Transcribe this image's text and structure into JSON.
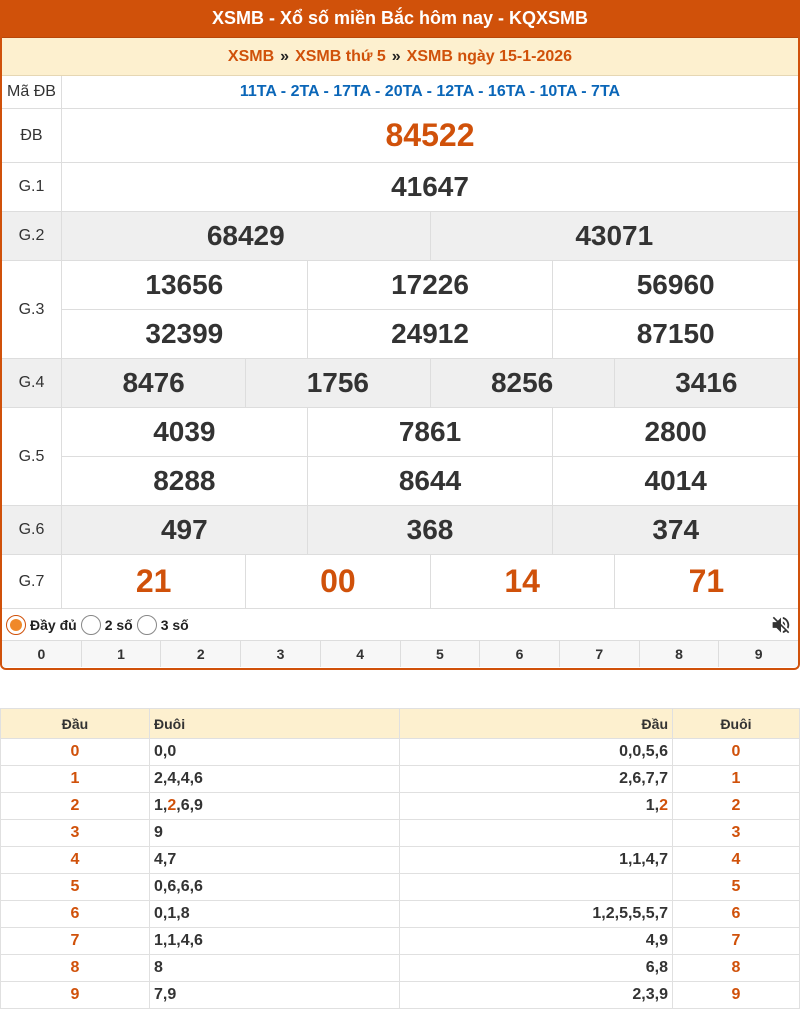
{
  "header": {
    "title": "XSMB - Xổ số miền Bắc hôm nay - KQXSMB"
  },
  "breadcrumb": {
    "item1": "XSMB",
    "item2": "XSMB thứ 5",
    "item3": "XSMB ngày 15-1-2026",
    "separator": "»"
  },
  "results": {
    "ma_db": {
      "label": "Mã ĐB",
      "codes": "11TA - 2TA - 17TA - 20TA - 12TA - 16TA - 10TA - 7TA"
    },
    "db": {
      "label": "ĐB",
      "numbers": [
        "84522"
      ]
    },
    "g1": {
      "label": "G.1",
      "numbers": [
        "41647"
      ]
    },
    "g2": {
      "label": "G.2",
      "numbers": [
        "68429",
        "43071"
      ]
    },
    "g3": {
      "label": "G.3",
      "numbers": [
        "13656",
        "17226",
        "56960",
        "32399",
        "24912",
        "87150"
      ]
    },
    "g4": {
      "label": "G.4",
      "numbers": [
        "8476",
        "1756",
        "8256",
        "3416"
      ]
    },
    "g5": {
      "label": "G.5",
      "numbers": [
        "4039",
        "7861",
        "2800",
        "8288",
        "8644",
        "4014"
      ]
    },
    "g6": {
      "label": "G.6",
      "numbers": [
        "497",
        "368",
        "374"
      ]
    },
    "g7": {
      "label": "G.7",
      "numbers": [
        "21",
        "00",
        "14",
        "71"
      ]
    }
  },
  "options": {
    "full": "Đầy đủ",
    "two": "2 số",
    "three": "3 số",
    "selected": "full"
  },
  "mute_icon": "volume-off-icon",
  "digits": [
    "0",
    "1",
    "2",
    "3",
    "4",
    "5",
    "6",
    "7",
    "8",
    "9"
  ],
  "loto_table": {
    "headers": {
      "dau": "Đầu",
      "duoi": "Đuôi",
      "dau2": "Đầu",
      "duoi2": "Đuôi"
    },
    "rows": [
      {
        "dau": "0",
        "duoi": "0,0",
        "dau2": "0,0,5,6",
        "duoi2": "0"
      },
      {
        "dau": "1",
        "duoi": "2,4,4,6",
        "dau2": "2,6,7,7",
        "duoi2": "1"
      },
      {
        "dau": "2",
        "duoi_pre": "1,",
        "duoi_hl": "2",
        "duoi_post": ",6,9",
        "dau2_pre": "1,",
        "dau2_hl": "2",
        "duoi2": "2"
      },
      {
        "dau": "3",
        "duoi": "9",
        "dau2": "",
        "duoi2": "3"
      },
      {
        "dau": "4",
        "duoi": "4,7",
        "dau2": "1,1,4,7",
        "duoi2": "4"
      },
      {
        "dau": "5",
        "duoi": "0,6,6,6",
        "dau2": "",
        "duoi2": "5"
      },
      {
        "dau": "6",
        "duoi": "0,1,8",
        "dau2": "1,2,5,5,5,7",
        "duoi2": "6"
      },
      {
        "dau": "7",
        "duoi": "1,1,4,6",
        "dau2": "4,9",
        "duoi2": "7"
      },
      {
        "dau": "8",
        "duoi": "8",
        "dau2": "6,8",
        "duoi2": "8"
      },
      {
        "dau": "9",
        "duoi": "7,9",
        "dau2": "2,3,9",
        "duoi2": "9"
      }
    ]
  },
  "colors": {
    "brand": "#d0510a",
    "code_blue": "#0a66b8",
    "header_bg": "#fdf0cf"
  }
}
